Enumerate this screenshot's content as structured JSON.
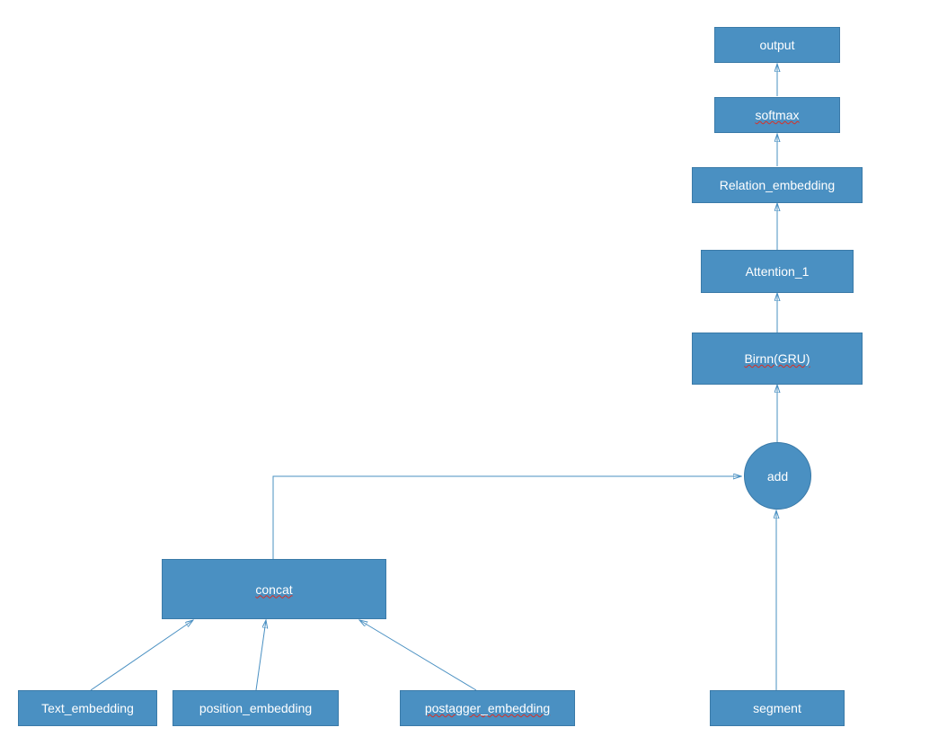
{
  "nodes": {
    "output": {
      "label": "output"
    },
    "softmax": {
      "label": "softmax"
    },
    "relation_embedding": {
      "label": "Relation_embedding"
    },
    "attention_1": {
      "label": "Attention_1"
    },
    "birnn_gru": {
      "label": "Birnn(GRU)"
    },
    "add": {
      "label": "add"
    },
    "concat": {
      "label": "concat"
    },
    "text_embedding": {
      "label": "Text_embedding"
    },
    "position_embedding": {
      "label": "position_embedding"
    },
    "postagger_embedding": {
      "label": "postagger_embedding"
    },
    "segment": {
      "label": "segment"
    }
  },
  "colors": {
    "node_fill": "#4a90c2",
    "node_border": "#3a7aa8",
    "connector": "#4a90c2"
  }
}
